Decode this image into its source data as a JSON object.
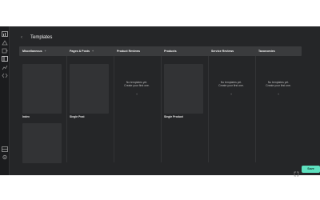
{
  "header": {
    "title": "Templates",
    "back_icon": "chevron-left-icon"
  },
  "rail": {
    "top_icons": [
      "dashboard-icon",
      "rocket-icon",
      "puzzle-icon",
      "templates-icon",
      "chart-icon",
      "code-icon"
    ],
    "bottom_icons": [
      "layers-icon",
      "settings-icon"
    ]
  },
  "tabs": [
    {
      "label": "Miscellaneous",
      "has_add": true
    },
    {
      "label": "Pages & Posts",
      "has_add": true
    },
    {
      "label": "Product Reviews",
      "has_add": false
    },
    {
      "label": "Products",
      "has_add": false
    },
    {
      "label": "Service Reviews",
      "has_add": false
    },
    {
      "label": "Taxonomies",
      "has_add": false
    }
  ],
  "cards": {
    "misc_index": "Index",
    "pages_single_post": "Single Post",
    "products_single_product": "Single Product"
  },
  "empty_state": {
    "line1": "No templates yet.",
    "line2": "Create your first one."
  },
  "footer": {
    "save_label": "Save"
  },
  "colors": {
    "accent": "#5ee0bf",
    "background": "#252628"
  }
}
